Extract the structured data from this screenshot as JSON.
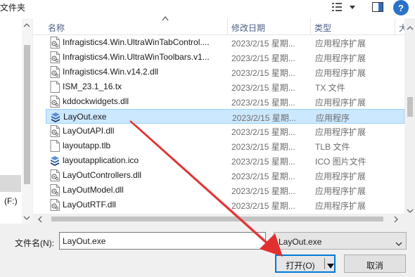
{
  "window": {
    "breadcrumb": "文件夹"
  },
  "toolbar": {
    "view_icon": "view-options-icon",
    "view_more_icon": "chevron-down-icon",
    "pane_icon": "preview-pane-icon",
    "help_label": "?"
  },
  "navpane": {
    "drive_label": "(F:)"
  },
  "columns": {
    "name": "名称",
    "date": "修改日期",
    "type": "类型",
    "size": "大"
  },
  "files": [
    {
      "name": "Infragistics4.Win.UltraWinTabControl....",
      "date": "2023/2/15 星期...",
      "type": "应用程序扩展",
      "icon": "dll-file-icon"
    },
    {
      "name": "Infragistics4.Win.UltraWinToolbars.v1...",
      "date": "2023/2/15 星期...",
      "type": "应用程序扩展",
      "icon": "dll-file-icon"
    },
    {
      "name": "Infragistics4.Win.v14.2.dll",
      "date": "2023/2/15 星期...",
      "type": "应用程序扩展",
      "icon": "dll-file-icon"
    },
    {
      "name": "ISM_23.1_16.tx",
      "date": "2023/2/15 星期...",
      "type": "TX 文件",
      "icon": "blank-file-icon"
    },
    {
      "name": "kddockwidgets.dll",
      "date": "2023/2/15 星期...",
      "type": "应用程序扩展",
      "icon": "dll-file-icon"
    },
    {
      "name": "LayOut.exe",
      "date": "2023/2/15 星期...",
      "type": "应用程序",
      "icon": "layout-app-icon",
      "selected": true
    },
    {
      "name": "LayOutAPI.dll",
      "date": "2023/2/15 星期...",
      "type": "应用程序扩展",
      "icon": "dll-file-icon"
    },
    {
      "name": "layoutapp.tlb",
      "date": "2023/2/15 星期...",
      "type": "TLB 文件",
      "icon": "blank-file-icon"
    },
    {
      "name": "layoutapplication.ico",
      "date": "2023/2/15 星期...",
      "type": "ICO 图片文件",
      "icon": "layout-app-icon"
    },
    {
      "name": "LayOutControllers.dll",
      "date": "2023/2/15 星期...",
      "type": "应用程序扩展",
      "icon": "dll-file-icon"
    },
    {
      "name": "LayOutModel.dll",
      "date": "2023/2/15 星期...",
      "type": "应用程序扩展",
      "icon": "dll-file-icon"
    },
    {
      "name": "LayOutRTF.dll",
      "date": "2023/2/15 星期...",
      "type": "应用程序扩展",
      "icon": "dll-file-icon"
    }
  ],
  "bottom": {
    "filename_label": "文件名(N):",
    "filename_value": "LayOut.exe",
    "filter_value": "LayOut.exe",
    "open_label": "打开(O)",
    "cancel_label": "取消"
  },
  "colors": {
    "annotation_arrow": "#e03030",
    "selection_bg": "#cce8ff",
    "accent": "#0078d7"
  }
}
